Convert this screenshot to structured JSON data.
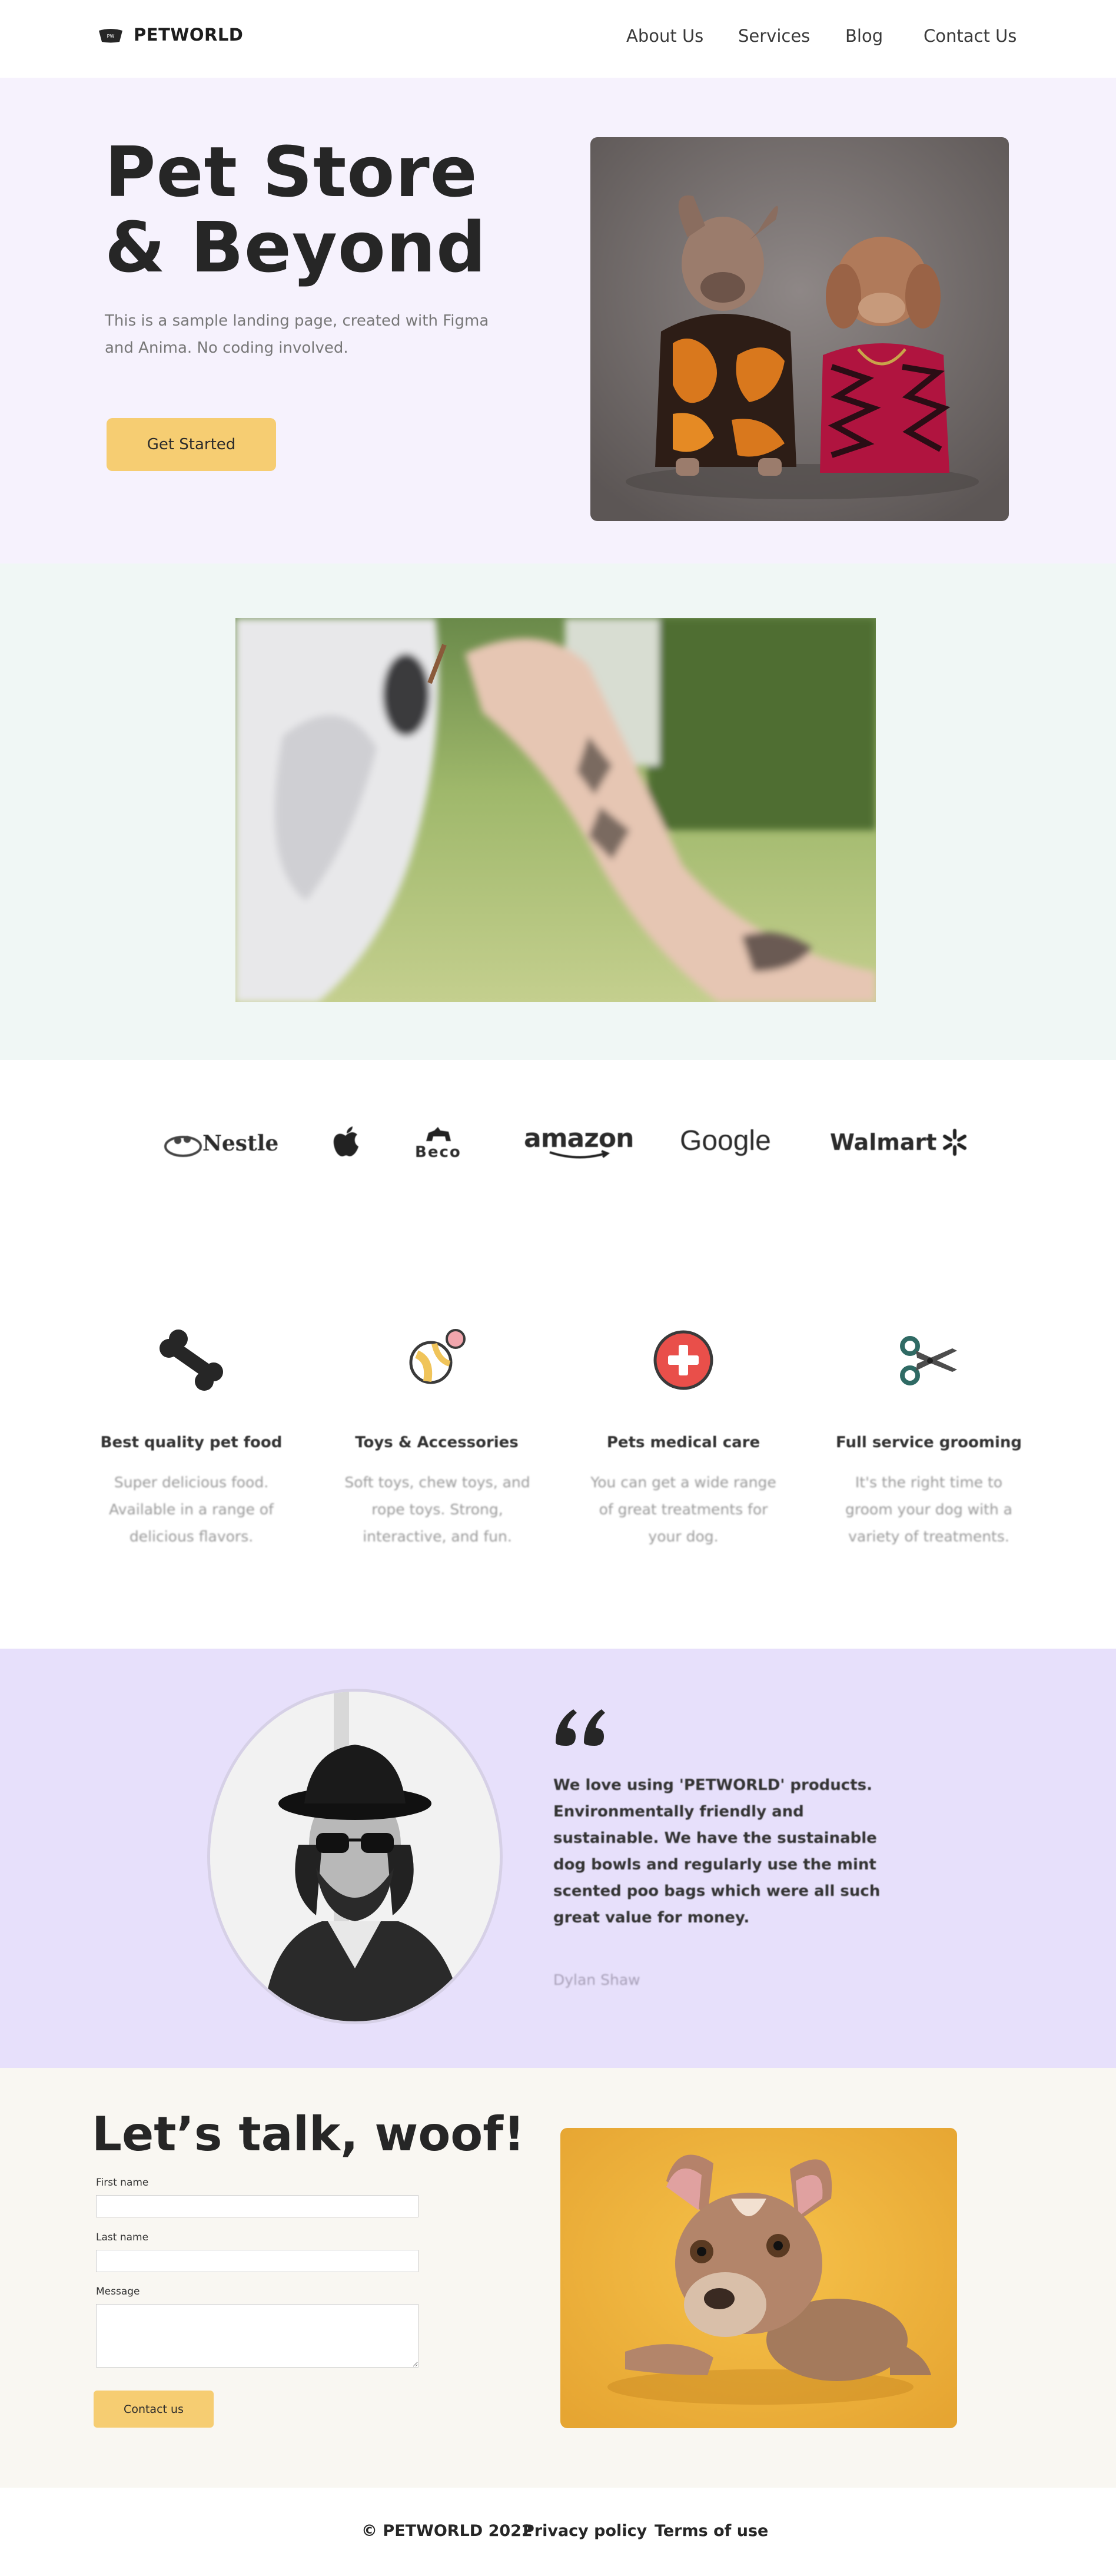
{
  "nav": {
    "brand": "PETWORLD",
    "logo_badge": "PW",
    "links": [
      "About Us",
      "Services",
      "Blog",
      "Contact Us"
    ]
  },
  "hero": {
    "title_line1": "Pet Store",
    "title_line2": "& Beyond",
    "subtitle": "This is a sample landing page, created with Figma and Anima. No coding involved.",
    "cta": "Get Started"
  },
  "partners": [
    "Nestle",
    "Apple",
    "Beco",
    "amazon",
    "Google",
    "Walmart"
  ],
  "services": [
    {
      "icon": "bone-icon",
      "title": "Best quality pet food",
      "desc": "Super delicious food. Available in a range of delicious flavors."
    },
    {
      "icon": "ball-icon",
      "title": "Toys & Accessories",
      "desc": "Soft toys, chew toys, and rope toys. Strong, interactive, and fun."
    },
    {
      "icon": "medical-cross-icon",
      "title": "Pets medical care",
      "desc": "You can get a wide range of great treatments for your dog."
    },
    {
      "icon": "scissors-icon",
      "title": "Full service grooming",
      "desc": "It's the right time to groom your dog with a variety of treatments."
    }
  ],
  "testimonial": {
    "quote": "We love using 'PETWORLD' products.  Environmentally friendly and sustainable. We have the sustainable dog bowls and regularly use the mint scented poo bags which were all such great value for money.",
    "author": "Dylan Shaw"
  },
  "contact": {
    "title": "Let’s talk, woof!",
    "first_name_label": "First name",
    "last_name_label": "Last name",
    "message_label": "Message",
    "button": "Contact us"
  },
  "footer": {
    "copyright": "© PETWORLD 2022",
    "privacy": "Privacy policy",
    "terms": "Terms of use"
  },
  "colors": {
    "accent": "#f6cd72",
    "hero_bg": "#f6f2fd",
    "video_bg": "#f0f7f5",
    "testimonial_bg": "#e7e0fb",
    "contact_bg": "#f9f7f2"
  }
}
